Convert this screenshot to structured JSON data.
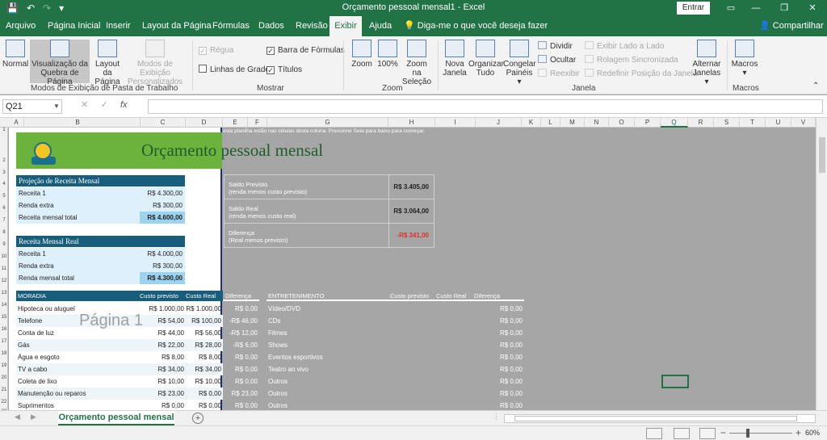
{
  "app": {
    "title": "Orçamento pessoal mensal1  -  Excel",
    "entrar": "Entrar",
    "qat": {
      "save": "💾",
      "undo": "↶",
      "redo": "↷"
    }
  },
  "tabs": [
    "Arquivo",
    "Página Inicial",
    "Inserir",
    "Layout da Página",
    "Fórmulas",
    "Dados",
    "Revisão",
    "Exibir",
    "Ajuda"
  ],
  "active_tab": "Exibir",
  "tell_me": "Diga-me o que você deseja fazer",
  "share": "Compartilhar",
  "ribbon": {
    "workbook_views": {
      "label": "Modos de Exibição de Pasta de Trabalho",
      "normal": "Normal",
      "page_break": [
        "Visualização da",
        "Quebra de Página"
      ],
      "page_layout": [
        "Layout",
        "da Página"
      ],
      "custom": [
        "Modos de Exibição",
        "Personalizados"
      ]
    },
    "show": {
      "label": "Mostrar",
      "ruler": "Régua",
      "formula_bar": "Barra de Fórmulas",
      "gridlines": "Linhas de Grade",
      "headings": "Títulos"
    },
    "zoom": {
      "label": "Zoom",
      "zoom": "Zoom",
      "hundred": "100%",
      "selection": [
        "Zoom na",
        "Seleção"
      ]
    },
    "window": {
      "label": "Janela",
      "new": [
        "Nova",
        "Janela"
      ],
      "arrange": [
        "Organizar",
        "Tudo"
      ],
      "freeze": [
        "Congelar",
        "Painéis ▾"
      ],
      "split": "Dividir",
      "hide": "Ocultar",
      "unhide": "Reexibir",
      "side_by_side": "Exibir Lado a Lado",
      "sync_scroll": "Rolagem Sincronizada",
      "reset_pos": "Redefinir Posição da Janela",
      "switch": [
        "Alternar",
        "Janelas ▾"
      ]
    },
    "macros": {
      "label": "Macros",
      "macros": [
        "Macros",
        "▾"
      ]
    }
  },
  "formula_bar": {
    "name_box": "Q21",
    "fx": "fx"
  },
  "columns": [
    "A",
    "B",
    "C",
    "D",
    "E",
    "F",
    "G",
    "H",
    "I",
    "J",
    "K",
    "L",
    "M",
    "N",
    "O",
    "P",
    "Q",
    "R",
    "S",
    "T",
    "U",
    "V"
  ],
  "selected_column": "Q",
  "rows": [
    "1",
    "2",
    "3",
    "4",
    "5",
    "6",
    "7",
    "8",
    "9",
    "10",
    "11",
    "12",
    "13",
    "14",
    "15",
    "16",
    "17",
    "18",
    "19",
    "20",
    "21",
    "22",
    "23"
  ],
  "sheet": {
    "title": "Orçamento pessoal mensal",
    "intro": "esta planilha estão nas células desta coluna. Pressione Seta para baixo para começar.",
    "watermark": "Página 1",
    "projecao": {
      "header": "Projeção de Receita Mensal",
      "rows": [
        {
          "label": "Receita 1",
          "value": "R$ 4.300,00"
        },
        {
          "label": "Renda extra",
          "value": "R$ 300,00"
        }
      ],
      "total_label": "Receita mensal total",
      "total": "R$ 4.600,00"
    },
    "real": {
      "header": "Receita Mensal Real",
      "rows": [
        {
          "label": "Receita 1",
          "value": "R$ 4.000,00"
        },
        {
          "label": "Renda extra",
          "value": "R$ 300,00"
        }
      ],
      "total_label": "Renda mensal total",
      "total": "R$ 4.300,00"
    },
    "summary": [
      {
        "l1": "Saldo Previsto",
        "l2": "(renda menos custo previsto)",
        "value": "R$ 3.405,00",
        "negative": false
      },
      {
        "l1": "Saldo Real",
        "l2": "(renda menos custo real)",
        "value": "R$ 3.064,00",
        "negative": false
      },
      {
        "l1": "Diferença",
        "l2": "(Real menos previsto)",
        "value": "-R$ 341,00",
        "negative": true
      }
    ],
    "moradia": {
      "headers": [
        "MORADIA",
        "Custo previsto",
        "Custo Real",
        "Diferença"
      ],
      "rows": [
        {
          "item": "Hipoteca ou aluguel",
          "prev": "R$ 1.000,00",
          "real": "R$ 1.000,00",
          "diff": "R$ 0,00"
        },
        {
          "item": "Telefone",
          "prev": "R$ 54,00",
          "real": "R$ 100,00",
          "diff": "-R$ 46,00"
        },
        {
          "item": "Conta de luz",
          "prev": "R$ 44,00",
          "real": "R$ 56,00",
          "diff": "-R$ 12,00"
        },
        {
          "item": "Gás",
          "prev": "R$ 22,00",
          "real": "R$ 28,00",
          "diff": "-R$ 6,00"
        },
        {
          "item": "Água e esgoto",
          "prev": "R$ 8,00",
          "real": "R$ 8,00",
          "diff": "R$ 0,00"
        },
        {
          "item": "TV a cabo",
          "prev": "R$ 34,00",
          "real": "R$ 34,00",
          "diff": "R$ 0,00"
        },
        {
          "item": "Coleta de lixo",
          "prev": "R$ 10,00",
          "real": "R$ 10,00",
          "diff": "R$ 0,00"
        },
        {
          "item": "Manutenção ou reparos",
          "prev": "R$ 23,00",
          "real": "R$ 0,00",
          "diff": "R$ 23,00"
        },
        {
          "item": "Suprimentos",
          "prev": "R$ 0,00",
          "real": "R$ 0,00",
          "diff": "R$ 0,00"
        }
      ]
    },
    "entretenimento": {
      "headers": [
        "ENTRETENIMENTO",
        "Custo previsto",
        "Custo Real",
        "Diferença"
      ],
      "rows": [
        {
          "item": "Vídeo/DVD",
          "diff": "R$ 0,00"
        },
        {
          "item": "CDs",
          "diff": "R$ 0,00"
        },
        {
          "item": "Filmes",
          "diff": "R$ 0,00"
        },
        {
          "item": "Shows",
          "diff": "R$ 0,00"
        },
        {
          "item": "Eventos esportivos",
          "diff": "R$ 0,00"
        },
        {
          "item": "Teatro ao vivo",
          "diff": "R$ 0,00"
        },
        {
          "item": "Outros",
          "diff": "R$ 0,00"
        },
        {
          "item": "Outros",
          "diff": "R$ 0,00"
        },
        {
          "item": "Outros",
          "diff": "R$ 0,00"
        }
      ]
    }
  },
  "sheet_tab": "Orçamento pessoal mensal",
  "add_sheet": "+",
  "status": {
    "zoom": "60%",
    "minus": "−",
    "plus": "+"
  }
}
